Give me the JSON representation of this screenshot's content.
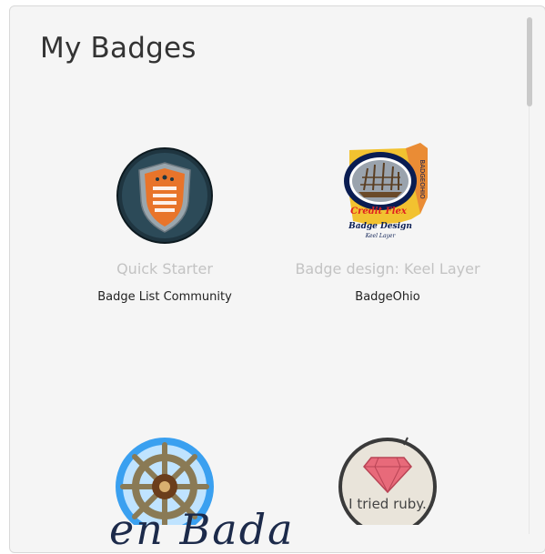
{
  "page": {
    "title": "My Badges"
  },
  "badges": [
    {
      "name": "Quick Starter",
      "issuer": "Badge List Community",
      "icon": "shield-badge-icon"
    },
    {
      "name": "Badge design: Keel Layer",
      "issuer": "BadgeOhio",
      "icon": "ohio-ship-badge-icon",
      "image_text": {
        "side": "BADGEOHIO",
        "top": "Credit Flex",
        "mid": "Badge Design",
        "bottom": "Keel Layer"
      }
    },
    {
      "name": "",
      "issuer": "",
      "icon": "ship-wheel-badge-icon"
    },
    {
      "name": "",
      "issuer": "",
      "icon": "ruby-badge-icon",
      "image_text": "I tried ruby."
    }
  ],
  "footer": {
    "text": "en Bada"
  }
}
